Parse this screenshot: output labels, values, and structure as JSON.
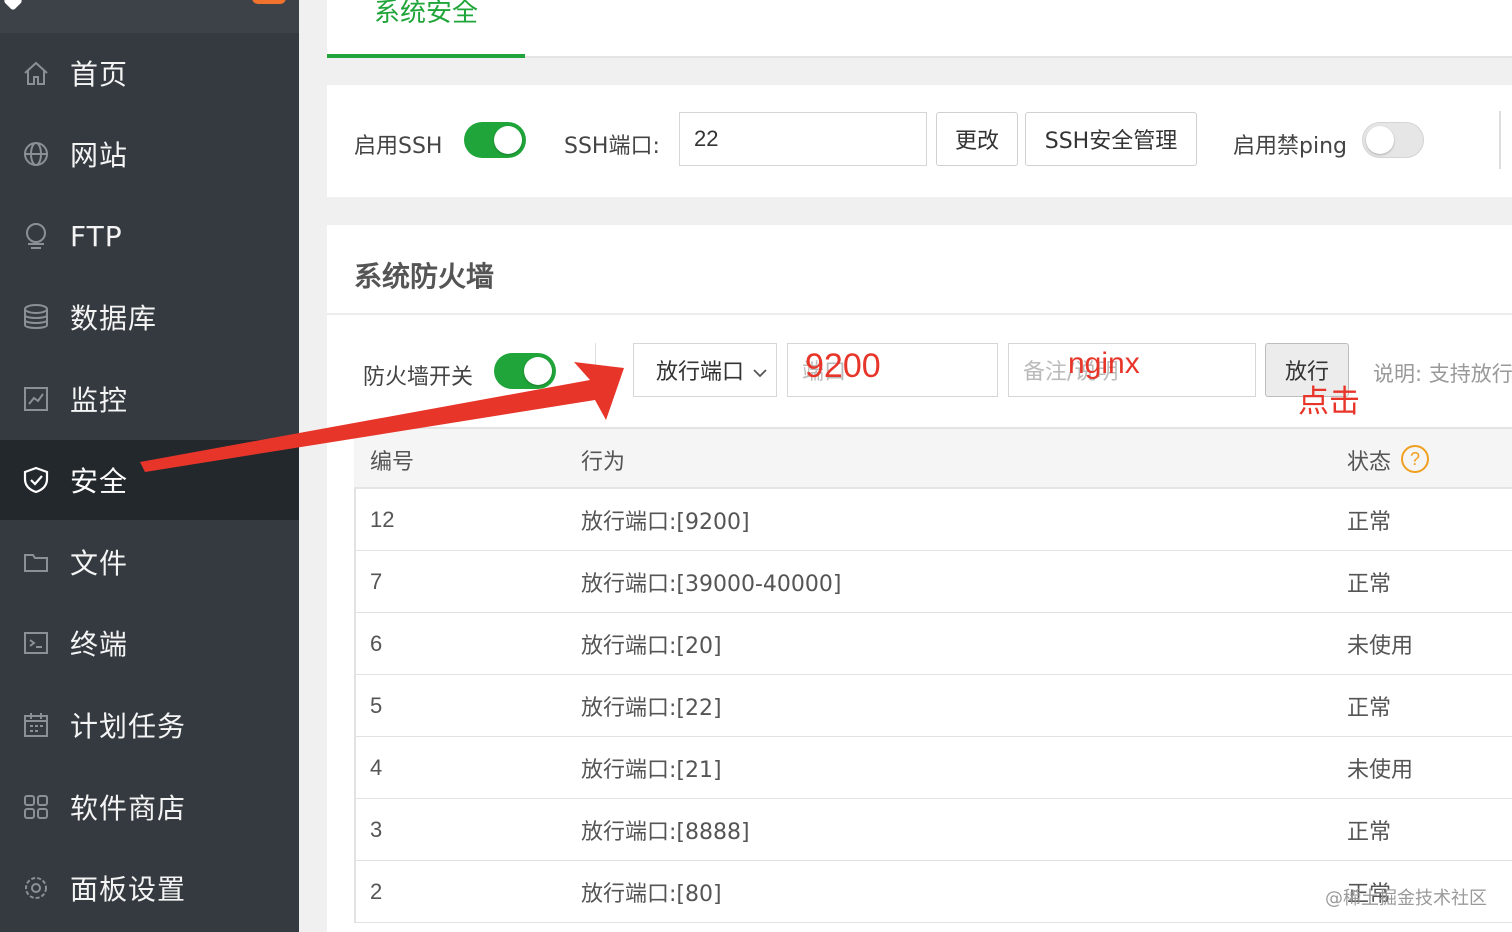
{
  "sidebar": {
    "items": [
      {
        "label": "首页",
        "icon": "home-icon"
      },
      {
        "label": "网站",
        "icon": "globe-icon"
      },
      {
        "label": "FTP",
        "icon": "ftp-icon"
      },
      {
        "label": "数据库",
        "icon": "database-icon"
      },
      {
        "label": "监控",
        "icon": "monitor-icon"
      },
      {
        "label": "安全",
        "icon": "shield-icon",
        "active": true
      },
      {
        "label": "文件",
        "icon": "folder-icon"
      },
      {
        "label": "终端",
        "icon": "terminal-icon"
      },
      {
        "label": "计划任务",
        "icon": "calendar-icon"
      },
      {
        "label": "软件商店",
        "icon": "apps-icon"
      },
      {
        "label": "面板设置",
        "icon": "gear-icon"
      }
    ]
  },
  "tabs": {
    "active": "系统安全"
  },
  "ssh": {
    "enable_label": "启用SSH",
    "port_label": "SSH端口:",
    "port_value": "22",
    "change_button": "更改",
    "manage_button": "SSH安全管理",
    "noping_label": "启用禁ping"
  },
  "firewall": {
    "title": "系统防火墙",
    "switch_label": "防火墙开关",
    "action_select": "放行端口",
    "port_placeholder": "端口",
    "port_value": "9200",
    "note_placeholder": "备注/说明",
    "note_value": "nginx",
    "allow_button": "放行",
    "hint": "说明: 支持放行"
  },
  "table": {
    "headers": {
      "id": "编号",
      "action": "行为",
      "status": "状态"
    },
    "rows": [
      {
        "id": "12",
        "action": "放行端口:[9200]",
        "status": "正常"
      },
      {
        "id": "7",
        "action": "放行端口:[39000-40000]",
        "status": "正常"
      },
      {
        "id": "6",
        "action": "放行端口:[20]",
        "status": "未使用"
      },
      {
        "id": "5",
        "action": "放行端口:[22]",
        "status": "正常"
      },
      {
        "id": "4",
        "action": "放行端口:[21]",
        "status": "未使用"
      },
      {
        "id": "3",
        "action": "放行端口:[8888]",
        "status": "正常"
      },
      {
        "id": "2",
        "action": "放行端口:[80]",
        "status": "正常"
      }
    ]
  },
  "annotations": {
    "click": "点击"
  },
  "watermark": "@稀土掘金技术社区",
  "colors": {
    "accent": "#20a53a",
    "annotation": "#e8352a",
    "sidebar": "#343a40",
    "help": "#f0a020"
  }
}
